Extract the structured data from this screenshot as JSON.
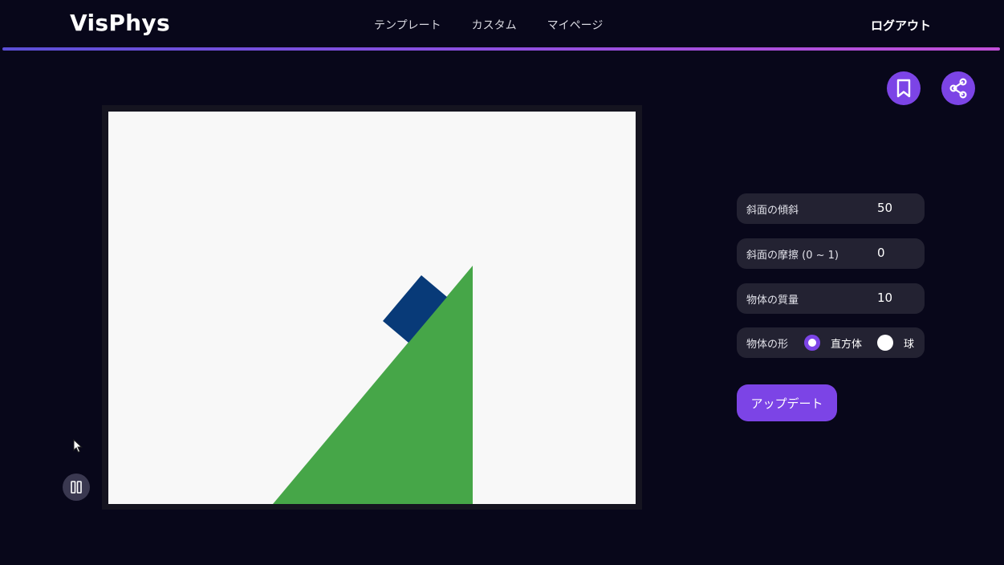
{
  "header": {
    "brand": "VisPhys",
    "nav": [
      {
        "label": "テンプレート"
      },
      {
        "label": "カスタム"
      },
      {
        "label": "マイページ"
      }
    ],
    "logout_label": "ログアウト"
  },
  "actions": {
    "bookmark_icon": "bookmark-icon",
    "share_icon": "share-icon"
  },
  "controls": {
    "incline": {
      "label": "斜面の傾斜",
      "value": "50"
    },
    "friction": {
      "label": "斜面の摩擦 (0 ~ 1)",
      "value": "0"
    },
    "mass": {
      "label": "物体の質量",
      "value": "10"
    },
    "shape": {
      "label": "物体の形",
      "options": [
        {
          "label": "直方体",
          "selected": true
        },
        {
          "label": "球",
          "selected": false
        }
      ]
    },
    "update_label": "アップデート"
  },
  "simulation": {
    "incline_color": "#46a648",
    "object_color": "#083a78"
  },
  "colors": {
    "accent": "#7c44e6",
    "background": "#08071a",
    "control_bg": "#232232"
  }
}
